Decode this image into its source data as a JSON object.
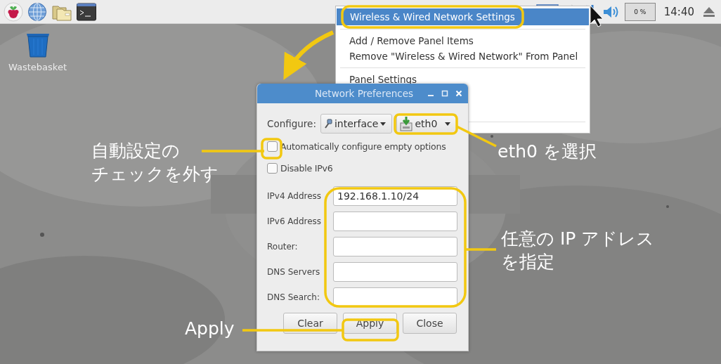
{
  "panel": {
    "cpu_monitor": "0 %",
    "clock": "14:40"
  },
  "desktop": {
    "icons": [
      {
        "label": "Wastebasket"
      }
    ]
  },
  "context_menu": {
    "sections": [
      {
        "items": [
          {
            "label": "Wireless & Wired Network Settings",
            "selected": true
          }
        ]
      },
      {
        "items": [
          {
            "label": "Add / Remove Panel Items",
            "selected": false
          },
          {
            "label": "Remove \"Wireless & Wired Network\" From Panel",
            "selected": false
          }
        ]
      },
      {
        "items": [
          {
            "label": "Panel Settings",
            "selected": false
          }
        ]
      }
    ]
  },
  "dialog": {
    "title": "Network Preferences",
    "configure_label": "Configure:",
    "configure_type": "interface",
    "interface": "eth0",
    "checkboxes": [
      {
        "label": "Automatically configure empty options",
        "checked": false
      },
      {
        "label": "Disable IPv6",
        "checked": false
      }
    ],
    "fields": [
      {
        "label": "IPv4 Address",
        "value": "192.168.1.10/24"
      },
      {
        "label": "IPv6 Address"
      },
      {
        "label": "Router:"
      },
      {
        "label": "DNS Servers"
      },
      {
        "label": "DNS Search:"
      }
    ],
    "buttons": [
      "Clear",
      "Apply",
      "Close"
    ]
  },
  "annotations": [
    {
      "lines": [
        "自動設定の",
        "チェックを外す"
      ]
    },
    {
      "lines": [
        "eth0 を選択"
      ]
    },
    {
      "lines": [
        "任意の IP アドレス",
        "を指定"
      ]
    },
    {
      "lines": [
        "Apply"
      ]
    }
  ]
}
